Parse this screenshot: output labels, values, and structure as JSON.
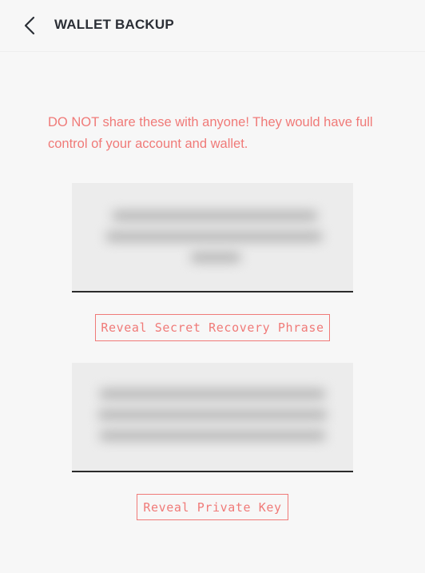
{
  "header": {
    "title": "WALLET BACKUP",
    "back_icon": "chevron-left-icon"
  },
  "warning": {
    "text": "DO NOT share these with anyone! They would have full control of your account and wallet."
  },
  "recovery_phrase": {
    "button_label": "Reveal Secret Recovery Phrase",
    "hidden": true
  },
  "private_key": {
    "button_label": "Reveal Private Key",
    "hidden": true
  },
  "colors": {
    "accent": "#f07a78",
    "title": "#2b2f36",
    "background": "#f7f7f7",
    "box": "#ececec"
  }
}
